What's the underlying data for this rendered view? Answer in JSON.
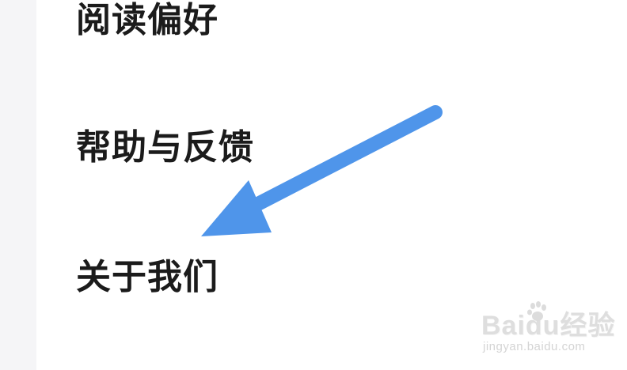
{
  "menu": {
    "items": [
      {
        "label": "阅读偏好"
      },
      {
        "label": "帮助与反馈"
      },
      {
        "label": "关于我们"
      }
    ]
  },
  "annotation": {
    "arrow_color": "#4f95ea",
    "icon": "arrow-pointer-icon"
  },
  "watermark": {
    "logo_text": "Baidu经验",
    "url": "jingyan.baidu.com",
    "color": "#d9d9d9"
  }
}
